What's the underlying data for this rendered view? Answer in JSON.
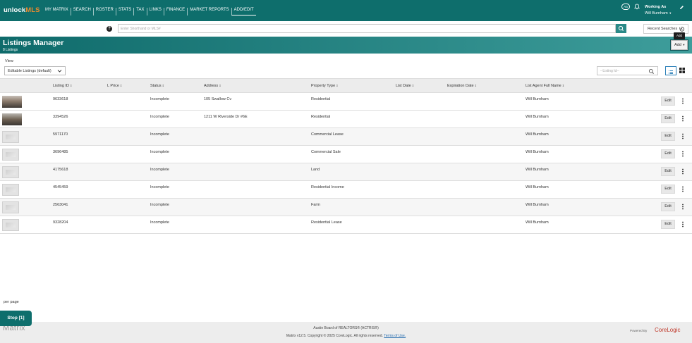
{
  "topnav": {
    "logo_prefix": "unlock",
    "logo_brand": "MLS",
    "links": [
      "MY MATRIX",
      "SEARCH",
      "ROSTER",
      "STATS",
      "TAX",
      "LINKS",
      "FINANCE",
      "MARKET REPORTS",
      "ADD/EDIT"
    ],
    "active_link": "ADD/EDIT",
    "aa_label": "Aa",
    "working_as_label": "Working As",
    "user_name": "Will Burnham"
  },
  "search": {
    "placeholder": "Enter Shorthand or MLS#",
    "recent_label": "Recent Searches"
  },
  "header": {
    "title": "Listings Manager",
    "count": "8 Listings",
    "add_label": "Add",
    "add_tooltip": "Add"
  },
  "view": {
    "label": "View",
    "selected": "Editable Listings (default)",
    "listing_id_placeholder": "--Listing Id--"
  },
  "table": {
    "columns": [
      "Listing ID",
      "L Price",
      "Status",
      "Address",
      "Property Type",
      "List Date",
      "Expiration Date",
      "List Agent Full Name"
    ],
    "edit_label": "Edit",
    "rows": [
      {
        "listing_id": "9633618",
        "price": "",
        "status": "Incomplete",
        "address": "105 Swallow Cv",
        "property_type": "Residential",
        "list_date": "",
        "expiration_date": "",
        "agent": "Will Burnham",
        "thumb": "photo"
      },
      {
        "listing_id": "3394526",
        "price": "",
        "status": "Incomplete",
        "address": "1211 W Riverside Dr #6E",
        "property_type": "Residential",
        "list_date": "",
        "expiration_date": "",
        "agent": "Will Burnham",
        "thumb": "photo"
      },
      {
        "listing_id": "5971170",
        "price": "",
        "status": "Incomplete",
        "address": "",
        "property_type": "Commercial Lease",
        "list_date": "",
        "expiration_date": "",
        "agent": "Will Burnham",
        "thumb": "placeholder"
      },
      {
        "listing_id": "3696485",
        "price": "",
        "status": "Incomplete",
        "address": "",
        "property_type": "Commercial Sale",
        "list_date": "",
        "expiration_date": "",
        "agent": "Will Burnham",
        "thumb": "placeholder"
      },
      {
        "listing_id": "4175618",
        "price": "",
        "status": "Incomplete",
        "address": "",
        "property_type": "Land",
        "list_date": "",
        "expiration_date": "",
        "agent": "Will Burnham",
        "thumb": "placeholder"
      },
      {
        "listing_id": "4545459",
        "price": "",
        "status": "Incomplete",
        "address": "",
        "property_type": "Residential Income",
        "list_date": "",
        "expiration_date": "",
        "agent": "Will Burnham",
        "thumb": "placeholder"
      },
      {
        "listing_id": "2563041",
        "price": "",
        "status": "Incomplete",
        "address": "",
        "property_type": "Farm",
        "list_date": "",
        "expiration_date": "",
        "agent": "Will Burnham",
        "thumb": "placeholder"
      },
      {
        "listing_id": "9328204",
        "price": "",
        "status": "Incomplete",
        "address": "",
        "property_type": "Residential Lease",
        "list_date": "",
        "expiration_date": "",
        "agent": "Will Burnham",
        "thumb": "placeholder"
      }
    ]
  },
  "bottom": {
    "per_page_label": "per page",
    "stop_label": "Stop [1]"
  },
  "footer": {
    "matrix_logo": "Matrix",
    "line1": "Austin Board of REALTORS® (ACTRIS®)",
    "line2": "Matrix v12.5. Copyright © 2025 CoreLogic. All rights reserved.",
    "terms_link": "Terms of Use.",
    "powered_by": "Powered By",
    "corelogic": "CoreLogic"
  },
  "colors": {
    "nav_bg": "#0e6e6c",
    "header_start": "#0f6b6b",
    "header_end": "#3e9d9b",
    "brand_orange": "#e98a2f",
    "corelogic_red": "#c0392b"
  }
}
